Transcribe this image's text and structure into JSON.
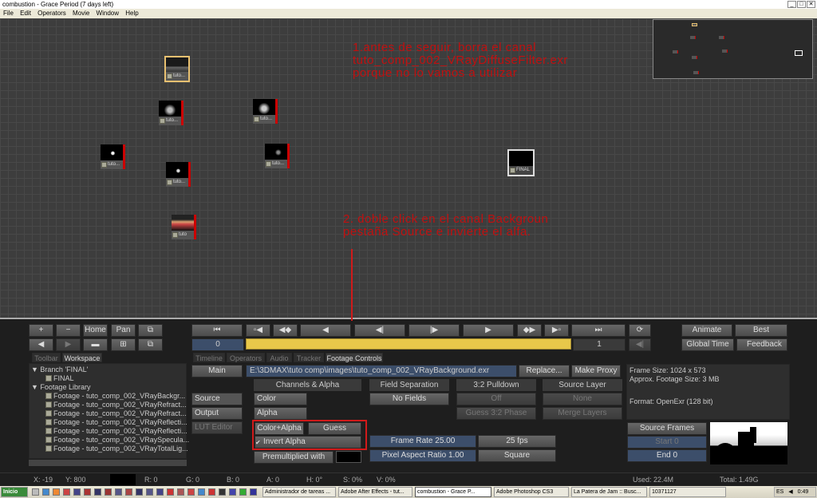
{
  "window": {
    "title": "combustion - Grace Period (7 days left)",
    "minimize": "_",
    "maximize": "□",
    "close": "✕"
  },
  "menu": [
    "File",
    "Edit",
    "Operators",
    "Movie",
    "Window",
    "Help"
  ],
  "workspace": {
    "nodes": [
      {
        "label": "tuto..."
      },
      {
        "label": "tuto..."
      },
      {
        "label": "tuto..."
      },
      {
        "label": "tuto..."
      },
      {
        "label": "tuto..."
      },
      {
        "label": "tuto..."
      },
      {
        "label": "tuto..."
      },
      {
        "label": "tuto"
      },
      {
        "label": "FINAL"
      }
    ],
    "annotation1": [
      "1.antes de seguir, borra el canal",
      "tuto_comp_002_VRayDiffuseFilter.exr",
      "porque no lo vamos a utilizar"
    ],
    "annotation2": [
      "2. doble click en el canal Backgroun",
      "pestaña Source e invierte el alfa."
    ],
    "annotation_color": "#c01010"
  },
  "viewer_controls": {
    "plus": "+",
    "minus": "−",
    "home": "Home",
    "pan": "Pan",
    "current_frame": "0",
    "end_frame": "1",
    "animate": "Animate",
    "quality": "Best",
    "global_time": "Global Time",
    "feedback": "Feedback",
    "timeline_color": "#e8c84a"
  },
  "tabs": {
    "left": [
      "Toolbar",
      "Workspace"
    ],
    "right": [
      "Timeline",
      "Operators",
      "Audio",
      "Tracker",
      "Footage Controls"
    ]
  },
  "tree": {
    "branch": "Branch 'FINAL'",
    "final": "FINAL",
    "library": "Footage Library",
    "items": [
      "Footage - tuto_comp_002_VRayBackgr...",
      "Footage - tuto_comp_002_VRayRefract...",
      "Footage - tuto_comp_002_VRayRefract...",
      "Footage - tuto_comp_002_VRayReflecti...",
      "Footage - tuto_comp_002_VRayReflecti...",
      "Footage - tuto_comp_002_VRaySpecula...",
      "Footage - tuto_comp_002_VRayTotalLig..."
    ]
  },
  "footage": {
    "side_tabs": [
      "Main",
      "Source",
      "Output",
      "LUT Editor"
    ],
    "path": "E:\\3DMAX\\tuto comp\\images\\tuto_comp_002_VRayBackground.exr",
    "replace": "Replace...",
    "make_proxy": "Make Proxy",
    "channels_header": "Channels & Alpha",
    "color": "Color",
    "alpha": "Alpha",
    "color_alpha": "Color+Alpha",
    "guess": "Guess",
    "invert_alpha": "Invert Alpha",
    "premultiplied": "Premultiplied with",
    "field_sep_header": "Field Separation",
    "no_fields": "No Fields",
    "frame_rate": "Frame Rate 25.00",
    "fps": "25 fps",
    "pixel_aspect": "Pixel Aspect Ratio 1.00",
    "square": "Square",
    "pulldown_header": "3:2 Pulldown",
    "off": "Off",
    "guess_pulldown": "Guess 3:2 Phase",
    "source_layer_header": "Source Layer",
    "none": "None",
    "merge_layers": "Merge Layers",
    "info_frame_size": "Frame Size: 1024 x 573",
    "info_approx": "Approx. Footage Size:    3 MB",
    "info_format": "Format: OpenExr (128 bit)",
    "source_frames": "Source Frames",
    "start": "Start 0",
    "end": "End 0",
    "highlight_color": "#d01a1a"
  },
  "status": {
    "x": "X:   -19",
    "y": "Y:   800",
    "r": "R: 0",
    "g": "G: 0",
    "b": "B: 0",
    "a": "A: 0",
    "h": "H: 0°",
    "s": "S: 0%",
    "v": "V: 0%",
    "used": "Used: 22.4M",
    "total": "Total: 1.49G"
  },
  "taskbar": {
    "start": "Inicio",
    "tasks": [
      "Administrador de tareas ...",
      "Adobe After Effects - tut...",
      "combustion - Grace P...",
      "Adobe Photoshop CS3",
      "La Patera de Jam :: Busc...",
      "10371127"
    ],
    "lang": "ES",
    "clock": "0:49"
  }
}
